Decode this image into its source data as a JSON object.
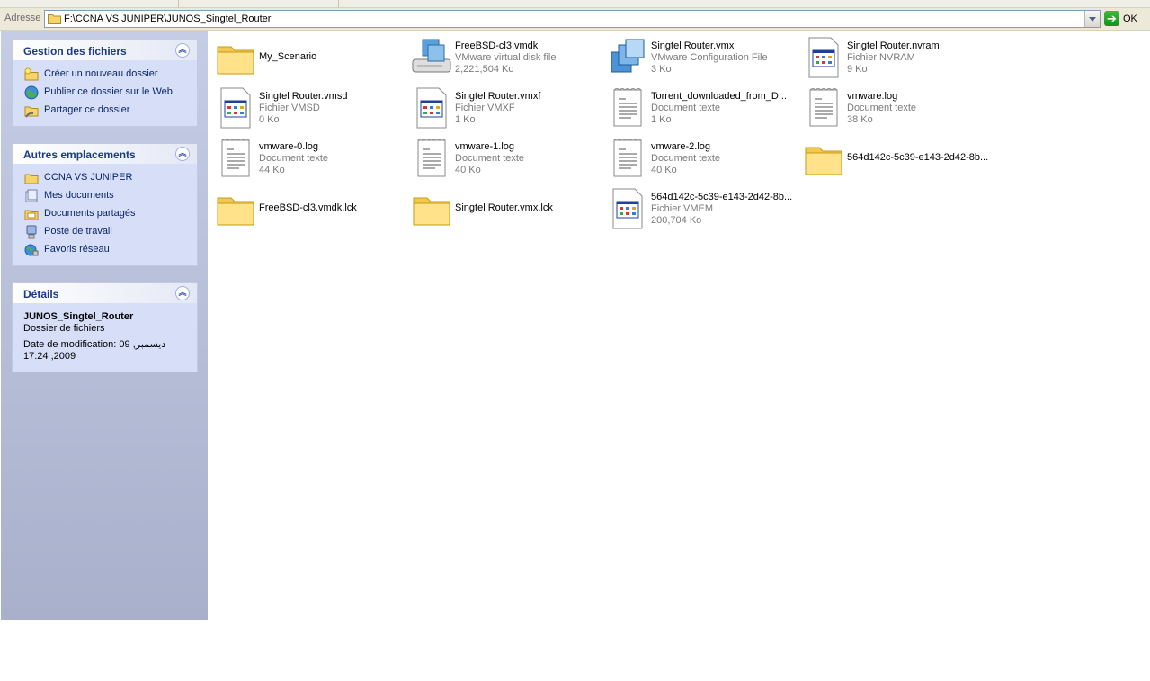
{
  "address_bar": {
    "label": "Adresse",
    "path": "F:\\CCNA VS JUNIPER\\JUNOS_Singtel_Router",
    "go_label": "OK"
  },
  "task_pane": {
    "file_tasks": {
      "title": "Gestion des fichiers",
      "items": [
        {
          "label": "Créer un nouveau dossier",
          "icon": "new-folder-icon"
        },
        {
          "label": "Publier ce dossier sur le Web",
          "icon": "publish-web-icon"
        },
        {
          "label": "Partager ce dossier",
          "icon": "share-folder-icon"
        }
      ]
    },
    "other_places": {
      "title": "Autres emplacements",
      "items": [
        {
          "label": "CCNA VS JUNIPER",
          "icon": "folder-icon"
        },
        {
          "label": "Mes documents",
          "icon": "my-documents-icon"
        },
        {
          "label": "Documents partagés",
          "icon": "shared-documents-icon"
        },
        {
          "label": "Poste de travail",
          "icon": "my-computer-icon"
        },
        {
          "label": "Favoris réseau",
          "icon": "network-places-icon"
        }
      ]
    },
    "details": {
      "title": "Détails",
      "name": "JUNOS_Singtel_Router",
      "type": "Dossier de fichiers",
      "modified": "Date de modification: 09 ديسمبر, 2009, 17:24"
    }
  },
  "files": [
    {
      "name": "My_Scenario",
      "type": "",
      "size": "",
      "icon": "folder"
    },
    {
      "name": "FreeBSD-cl3.vmdk",
      "type": "VMware virtual disk file",
      "size": "2,221,504 Ko",
      "icon": "vmdk"
    },
    {
      "name": "Singtel Router.vmx",
      "type": "VMware Configuration File",
      "size": "3 Ko",
      "icon": "vmx"
    },
    {
      "name": "Singtel Router.nvram",
      "type": "Fichier NVRAM",
      "size": "9 Ko",
      "icon": "app"
    },
    {
      "name": "Singtel Router.vmsd",
      "type": "Fichier VMSD",
      "size": "0 Ko",
      "icon": "app"
    },
    {
      "name": "Singtel Router.vmxf",
      "type": "Fichier VMXF",
      "size": "1 Ko",
      "icon": "app"
    },
    {
      "name": "Torrent_downloaded_from_D...",
      "type": "Document texte",
      "size": "1 Ko",
      "icon": "text"
    },
    {
      "name": "vmware.log",
      "type": "Document texte",
      "size": "38 Ko",
      "icon": "text"
    },
    {
      "name": "vmware-0.log",
      "type": "Document texte",
      "size": "44 Ko",
      "icon": "text"
    },
    {
      "name": "vmware-1.log",
      "type": "Document texte",
      "size": "40 Ko",
      "icon": "text"
    },
    {
      "name": "vmware-2.log",
      "type": "Document texte",
      "size": "40 Ko",
      "icon": "text"
    },
    {
      "name": "564d142c-5c39-e143-2d42-8b...",
      "type": "",
      "size": "",
      "icon": "folder"
    },
    {
      "name": "FreeBSD-cl3.vmdk.lck",
      "type": "",
      "size": "",
      "icon": "folder"
    },
    {
      "name": "Singtel Router.vmx.lck",
      "type": "",
      "size": "",
      "icon": "folder"
    },
    {
      "name": "564d142c-5c39-e143-2d42-8b...",
      "type": "Fichier VMEM",
      "size": "200,704 Ko",
      "icon": "app"
    }
  ]
}
